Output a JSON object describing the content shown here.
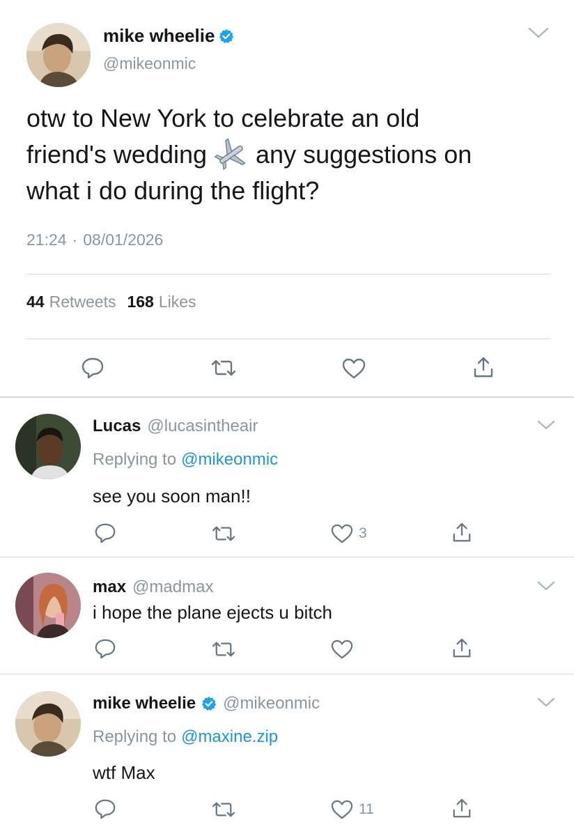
{
  "main_tweet": {
    "author_name": "mike wheelie",
    "author_handle": "@mikeonmic",
    "text_line1": "otw to New York to celebrate an old",
    "text_line2a": "friend's wedding",
    "text_line2b": "any suggestions on",
    "text_line3": "what i do during the flight?",
    "emoji": "✈️",
    "time": "21:24",
    "dot": "·",
    "date": "08/01/2026",
    "retweets_count": "44",
    "retweets_label": "Retweets",
    "likes_count": "168",
    "likes_label": "Likes"
  },
  "replies": [
    {
      "author_name": "Lucas",
      "author_handle": "@lucasintheair",
      "replying_label": "Replying to",
      "replying_to": "@mikeonmic",
      "text": "see you soon man!!",
      "likes": "3"
    },
    {
      "author_name": "max",
      "author_handle": "@madmax",
      "text": "i hope the plane ejects u bitch"
    },
    {
      "author_name": "mike wheelie",
      "author_handle": "@mikeonmic",
      "replying_label": "Replying to",
      "replying_to": "@maxine.zip",
      "text": "wtf Max",
      "likes": "11"
    }
  ],
  "colors": {
    "link": "#1b95e0",
    "verified": "#1da1f2",
    "muted": "#8a959e",
    "icon": "#657786"
  }
}
